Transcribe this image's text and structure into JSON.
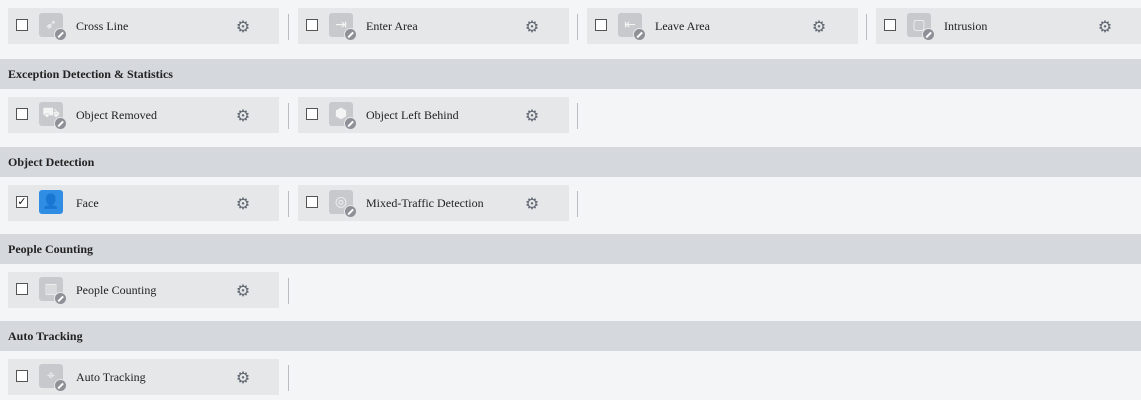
{
  "rows": [
    {
      "items": [
        {
          "label": "Cross Line",
          "checked": false,
          "icon": "cross-line-icon",
          "glyph": "⏵"
        },
        {
          "label": "Enter Area",
          "checked": false,
          "icon": "enter-area-icon",
          "glyph": "⮕"
        },
        {
          "label": "Leave Area",
          "checked": false,
          "icon": "leave-area-icon",
          "glyph": "⮕"
        },
        {
          "label": "Intrusion",
          "checked": false,
          "icon": "intrusion-icon",
          "glyph": "□"
        }
      ]
    },
    {
      "section": "Exception Detection & Statistics"
    },
    {
      "items": [
        {
          "label": "Object Removed",
          "checked": false,
          "icon": "object-removed-icon",
          "glyph": "❖"
        },
        {
          "label": "Object Left Behind",
          "checked": false,
          "icon": "object-left-behind-icon",
          "glyph": "◆"
        }
      ]
    },
    {
      "section": "Object Detection"
    },
    {
      "items": [
        {
          "label": "Face",
          "checked": true,
          "icon": "face-icon",
          "glyph": "☺"
        },
        {
          "label": "Mixed-Traffic Detection",
          "checked": false,
          "icon": "mixed-traffic-icon",
          "glyph": "◎"
        }
      ]
    },
    {
      "section": "People Counting"
    },
    {
      "items": [
        {
          "label": "People Counting",
          "checked": false,
          "icon": "people-counting-icon",
          "glyph": "▐"
        }
      ]
    },
    {
      "section": "Auto Tracking"
    },
    {
      "items": [
        {
          "label": "Auto Tracking",
          "checked": false,
          "icon": "auto-tracking-icon",
          "glyph": "⌖"
        }
      ]
    }
  ]
}
